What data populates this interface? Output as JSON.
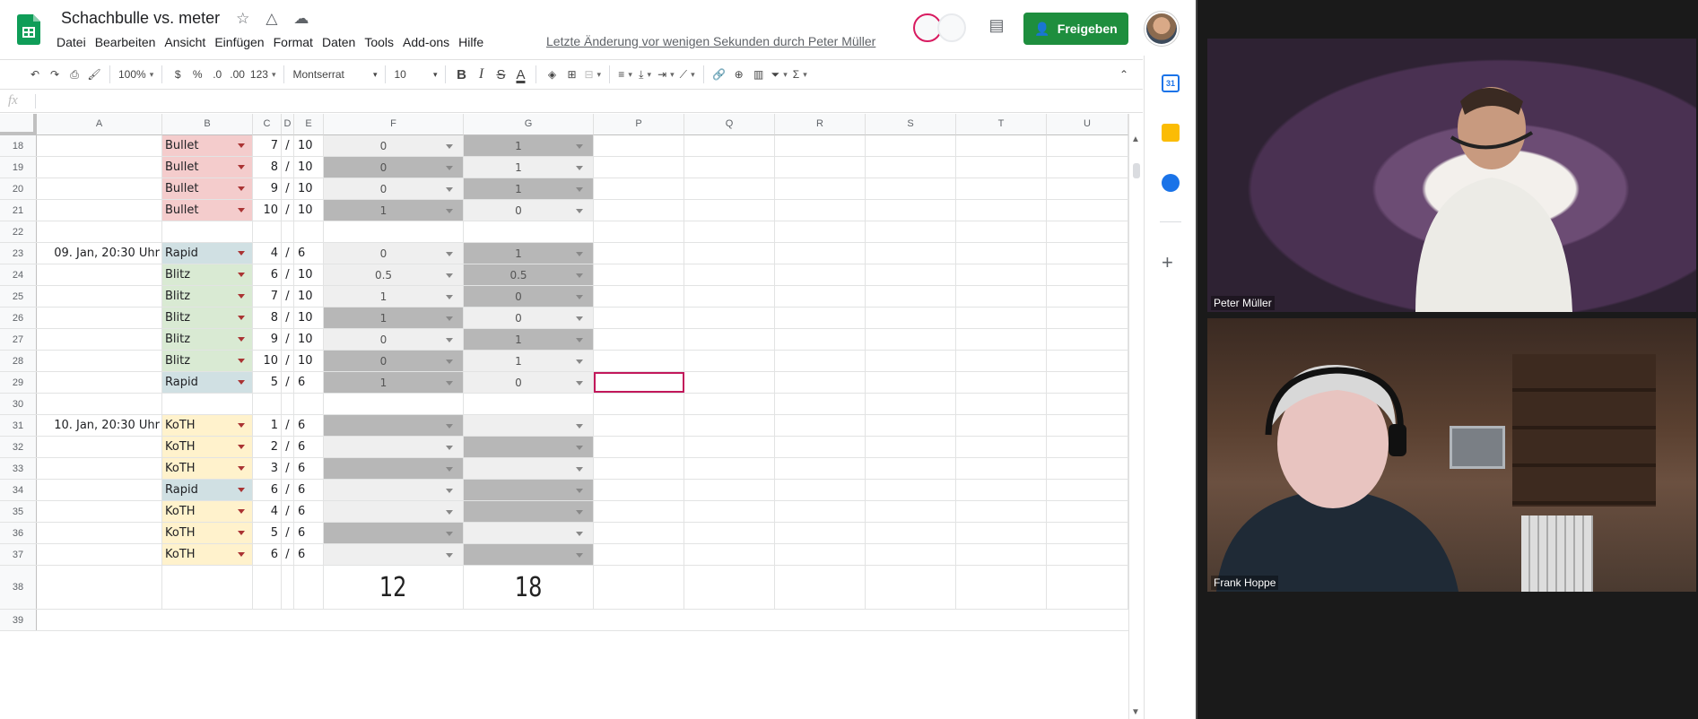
{
  "doc": {
    "title": "Schachbulle vs. meter",
    "last_edit": "Letzte Änderung vor wenigen Sekunden durch Peter Müller",
    "share_label": "Freigeben"
  },
  "menu": [
    "Datei",
    "Bearbeiten",
    "Ansicht",
    "Einfügen",
    "Format",
    "Daten",
    "Tools",
    "Add-ons",
    "Hilfe"
  ],
  "toolbar": {
    "zoom": "100%",
    "currency": "$",
    "percent": "%",
    "dec_decrease": ".0",
    "dec_increase": ".00",
    "number_format": "123",
    "font": "Montserrat",
    "font_size": "10",
    "bold": "B",
    "italic": "I",
    "strike": "S",
    "text_color": "A"
  },
  "formula_bar": {
    "label": "fx",
    "value": ""
  },
  "columns": [
    "A",
    "B",
    "C",
    "D",
    "E",
    "F",
    "G",
    "P",
    "Q",
    "R",
    "S",
    "T",
    "U"
  ],
  "rows": [
    {
      "n": "18",
      "a": "",
      "b": "Bullet",
      "c": "7",
      "d": "/",
      "e": "10",
      "f": "0",
      "g": "1"
    },
    {
      "n": "19",
      "a": "",
      "b": "Bullet",
      "c": "8",
      "d": "/",
      "e": "10",
      "f": "0",
      "g": "1"
    },
    {
      "n": "20",
      "a": "",
      "b": "Bullet",
      "c": "9",
      "d": "/",
      "e": "10",
      "f": "0",
      "g": "1"
    },
    {
      "n": "21",
      "a": "",
      "b": "Bullet",
      "c": "10",
      "d": "/",
      "e": "10",
      "f": "1",
      "g": "0"
    },
    {
      "n": "22",
      "a": "",
      "b": "",
      "c": "",
      "d": "",
      "e": "",
      "f": "",
      "g": ""
    },
    {
      "n": "23",
      "a": "09. Jan, 20:30 Uhr",
      "b": "Rapid",
      "c": "4",
      "d": "/",
      "e": "6",
      "f": "0",
      "g": "1"
    },
    {
      "n": "24",
      "a": "",
      "b": "Blitz",
      "c": "6",
      "d": "/",
      "e": "10",
      "f": "0.5",
      "g": "0.5"
    },
    {
      "n": "25",
      "a": "",
      "b": "Blitz",
      "c": "7",
      "d": "/",
      "e": "10",
      "f": "1",
      "g": "0"
    },
    {
      "n": "26",
      "a": "",
      "b": "Blitz",
      "c": "8",
      "d": "/",
      "e": "10",
      "f": "1",
      "g": "0"
    },
    {
      "n": "27",
      "a": "",
      "b": "Blitz",
      "c": "9",
      "d": "/",
      "e": "10",
      "f": "0",
      "g": "1"
    },
    {
      "n": "28",
      "a": "",
      "b": "Blitz",
      "c": "10",
      "d": "/",
      "e": "10",
      "f": "0",
      "g": "1"
    },
    {
      "n": "29",
      "a": "",
      "b": "Rapid",
      "c": "5",
      "d": "/",
      "e": "6",
      "f": "1",
      "g": "0"
    },
    {
      "n": "30",
      "a": "",
      "b": "",
      "c": "",
      "d": "",
      "e": "",
      "f": "",
      "g": ""
    },
    {
      "n": "31",
      "a": "10. Jan, 20:30 Uhr",
      "b": "KoTH",
      "c": "1",
      "d": "/",
      "e": "6",
      "f": "",
      "g": ""
    },
    {
      "n": "32",
      "a": "",
      "b": "KoTH",
      "c": "2",
      "d": "/",
      "e": "6",
      "f": "",
      "g": ""
    },
    {
      "n": "33",
      "a": "",
      "b": "KoTH",
      "c": "3",
      "d": "/",
      "e": "6",
      "f": "",
      "g": ""
    },
    {
      "n": "34",
      "a": "",
      "b": "Rapid",
      "c": "6",
      "d": "/",
      "e": "6",
      "f": "",
      "g": ""
    },
    {
      "n": "35",
      "a": "",
      "b": "KoTH",
      "c": "4",
      "d": "/",
      "e": "6",
      "f": "",
      "g": ""
    },
    {
      "n": "36",
      "a": "",
      "b": "KoTH",
      "c": "5",
      "d": "/",
      "e": "6",
      "f": "",
      "g": ""
    },
    {
      "n": "37",
      "a": "",
      "b": "KoTH",
      "c": "6",
      "d": "/",
      "e": "6",
      "f": "",
      "g": ""
    }
  ],
  "totals": {
    "n": "38",
    "f": "12",
    "g": "18"
  },
  "next_row": "39",
  "video": {
    "participant1": "Peter Müller",
    "participant2": "Frank Hoppe"
  },
  "side_panel": {
    "calendar_day": "31"
  },
  "colors": {
    "bullet": "#f4cccc",
    "rapid": "#d0e0e3",
    "blitz": "#d9ead3",
    "koth": "#fff2cc",
    "score_dark": "#b7b7b7",
    "score_light": "#efefef",
    "share": "#1e8e3e",
    "selection": "#c2185b"
  }
}
